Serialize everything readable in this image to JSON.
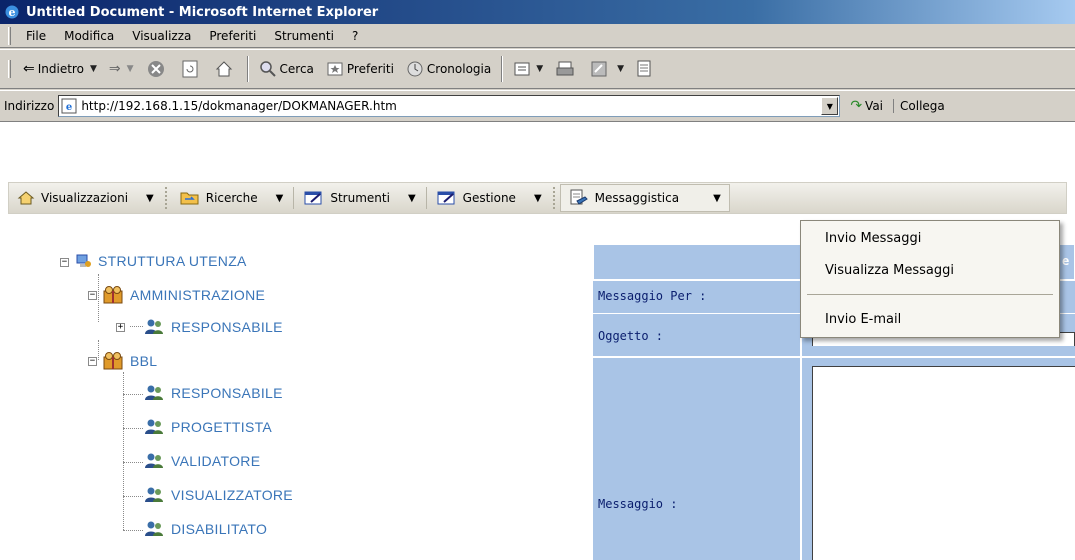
{
  "window": {
    "title": "Untitled Document - Microsoft Internet Explorer"
  },
  "menubar": {
    "items": [
      "File",
      "Modifica",
      "Visualizza",
      "Preferiti",
      "Strumenti",
      "?"
    ]
  },
  "toolbar": {
    "back": "Indietro",
    "search": "Cerca",
    "favorites": "Preferiti",
    "history": "Cronologia"
  },
  "address": {
    "label": "Indirizzo",
    "url": "http://192.168.1.15/dokmanager/DOKMANAGER.htm",
    "go": "Vai",
    "links": "Collega"
  },
  "appmenu": {
    "items": [
      "Visualizzazioni",
      "Ricerche",
      "Strumenti",
      "Gestione",
      "Messaggistica"
    ],
    "open": "Messaggistica"
  },
  "dropdown": {
    "items": [
      "Invio Messaggi",
      "Visualizza Messaggi",
      "Invio E-mail"
    ]
  },
  "tree": {
    "root": "STRUTTURA UTENZA",
    "nodes": [
      {
        "label": "AMMINISTRAZIONE"
      },
      {
        "label": "RESPONSABILE"
      },
      {
        "label": "BBL"
      },
      {
        "label": "RESPONSABILE"
      },
      {
        "label": "PROGETTISTA"
      },
      {
        "label": "VALIDATORE"
      },
      {
        "label": "VISUALIZZATORE"
      },
      {
        "label": "DISABILITATO"
      }
    ]
  },
  "form": {
    "header_partial": "e",
    "recipient_label": "Messaggio Per :",
    "subject_label": "Oggetto :",
    "message_label": "Messaggio :"
  }
}
